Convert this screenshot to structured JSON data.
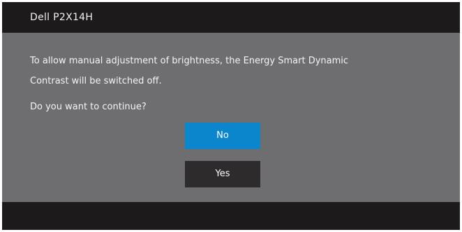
{
  "title": "Dell P2X14H",
  "message": {
    "line1": "To allow manual adjustment of brightness, the Energy Smart Dynamic",
    "line2": "Contrast will be switched off.",
    "line3": "Do you want to continue?"
  },
  "buttons": {
    "no_label": "No",
    "yes_label": "Yes"
  },
  "colors": {
    "frame": "#1c1a1b",
    "panel": "#6e6e70",
    "selected_button": "#0a86cc",
    "button": "#2d2b2c"
  }
}
